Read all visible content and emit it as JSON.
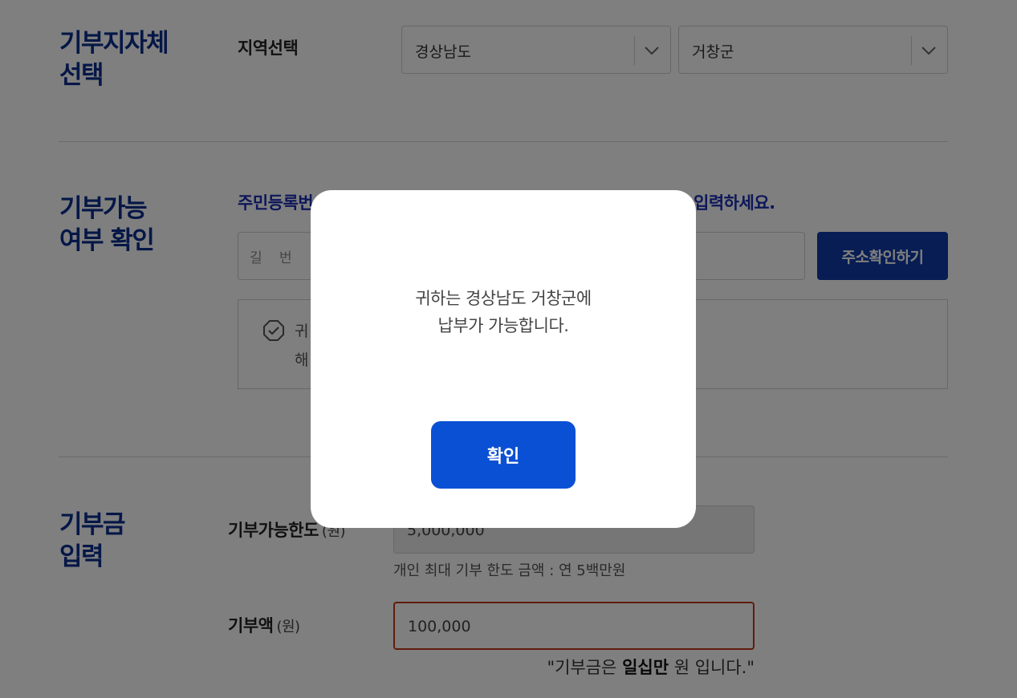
{
  "region_section": {
    "title_line1": "기부지자체",
    "title_line2": "선택",
    "label": "지역선택",
    "province": "경상남도",
    "district": "거창군"
  },
  "eligibility_section": {
    "title_line1": "기부가능",
    "title_line2": "여부 확인",
    "instruction_start": "주민등록번",
    "instruction_end": "입력하세요.",
    "address_partial": "길 번",
    "check_button": "주소확인하기",
    "result_line1_start": "귀",
    "result_line2_start": "해"
  },
  "amount_section": {
    "title_line1": "기부금",
    "title_line2": "입력",
    "limit_label": "기부가능한도",
    "limit_unit": "(원)",
    "limit_value": "5,000,000",
    "limit_help": "개인 최대 기부 한도 금액 : 연 5백만원",
    "amount_label": "기부액",
    "amount_unit": "(원)",
    "amount_value": "100,000",
    "amount_quote_prefix": "\"기부금은 ",
    "amount_quote_bold": "일십만",
    "amount_quote_suffix": " 원 입니다.\""
  },
  "modal": {
    "message_line1": "귀하는 경상남도 거창군에",
    "message_line2": "납부가 가능합니다.",
    "confirm_label": "확인"
  },
  "colors": {
    "section_title": "#0a2f8f",
    "primary_button": "#0e3ba8",
    "modal_button": "#0a50d4",
    "error_border": "#c0391b"
  }
}
